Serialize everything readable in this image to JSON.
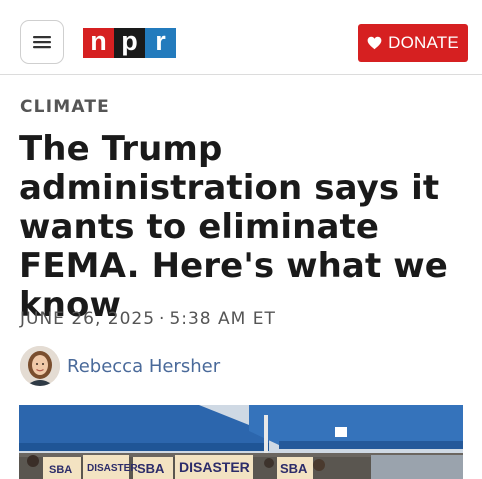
{
  "header": {
    "logo": {
      "letters": [
        "n",
        "p",
        "r"
      ]
    },
    "donate_label": "DONATE",
    "brand_red": "#d62021",
    "brand_blue": "#237bbd"
  },
  "article": {
    "section": "CLIMATE",
    "headline": "The Trump administration says it wants to eliminate FEMA. Here's what we know",
    "date": "JUNE 26, 2025",
    "time": "5:38 AM ET",
    "author": "Rebecca Hersher"
  },
  "photo": {
    "signs": [
      "SBA",
      "DISASTER",
      "SBA",
      "DISASTER",
      "SBA"
    ]
  }
}
